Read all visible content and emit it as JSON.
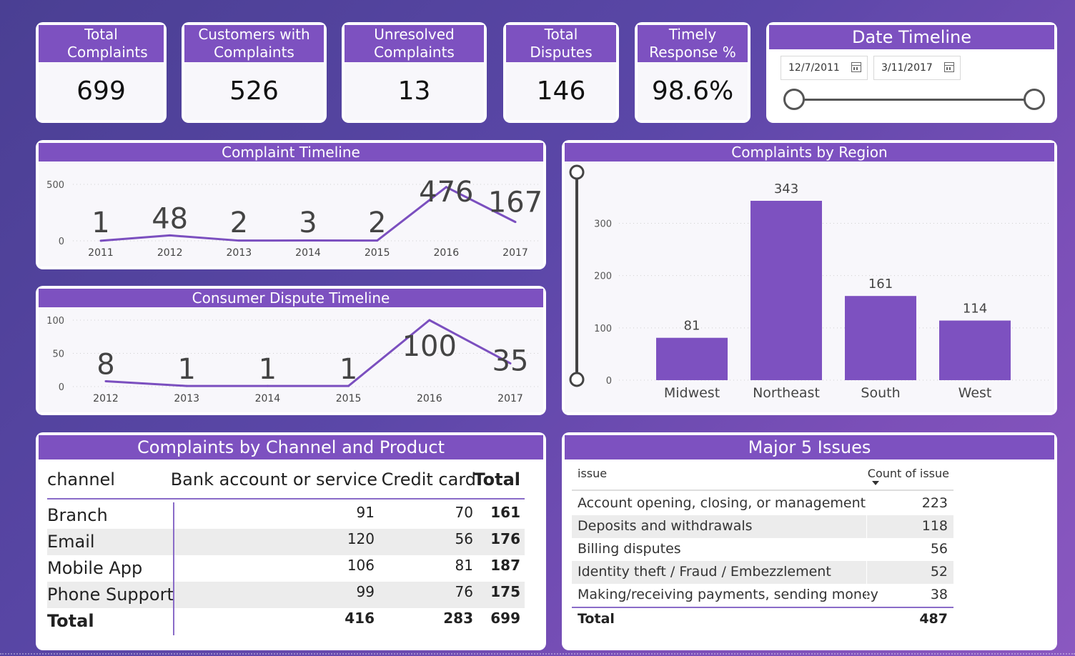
{
  "kpis": {
    "total_complaints": {
      "label": "Total Complaints",
      "value": "699"
    },
    "customers_with_complaints": {
      "label": "Customers with Complaints",
      "value": "526"
    },
    "unresolved_complaints": {
      "label": "Unresolved Complaints",
      "value": "13"
    },
    "total_disputes": {
      "label": "Total Disputes",
      "value": "146"
    },
    "timely_response": {
      "label": "Timely Response %",
      "value": "98.6%"
    }
  },
  "date_timeline": {
    "title": "Date Timeline",
    "start": "12/7/2011",
    "end": "3/11/2017",
    "icon": "calendar-icon"
  },
  "colors": {
    "accent": "#7d51c0",
    "line": "#7b4fbf",
    "bar": "#7d51c0",
    "grid": "#d0d0d0"
  },
  "chart_data": [
    {
      "id": "complaint_timeline",
      "type": "line",
      "title": "Complaint Timeline",
      "x": [
        "2011",
        "2012",
        "2013",
        "2014",
        "2015",
        "2016",
        "2017"
      ],
      "values": [
        1,
        48,
        2,
        3,
        2,
        476,
        167
      ],
      "yticks": [
        0,
        500
      ],
      "ylim": [
        0,
        500
      ],
      "grid": true,
      "data_labels": true
    },
    {
      "id": "dispute_timeline",
      "type": "line",
      "title": "Consumer Dispute Timeline",
      "x": [
        "2012",
        "2013",
        "2014",
        "2015",
        "2016",
        "2017"
      ],
      "values": [
        8,
        1,
        1,
        1,
        100,
        35
      ],
      "yticks": [
        0,
        50,
        100
      ],
      "ylim": [
        0,
        100
      ],
      "grid": true,
      "data_labels": true
    },
    {
      "id": "region",
      "type": "bar",
      "title": "Complaints by Region",
      "categories": [
        "Midwest",
        "Northeast",
        "South",
        "West"
      ],
      "values": [
        81,
        343,
        161,
        114
      ],
      "yticks": [
        0,
        100,
        200,
        300
      ],
      "ylim": [
        0,
        343
      ],
      "grid": true,
      "data_labels": true
    },
    {
      "id": "channel_product",
      "type": "table",
      "title": "Complaints by Channel and Product",
      "columns": [
        "channel",
        "Bank account or service",
        "Credit card",
        "Total"
      ],
      "rows": [
        [
          "Branch",
          "91",
          "70",
          "161"
        ],
        [
          "Email",
          "120",
          "56",
          "176"
        ],
        [
          "Mobile App",
          "106",
          "81",
          "187"
        ],
        [
          "Phone Support",
          "99",
          "76",
          "175"
        ]
      ],
      "total": [
        "Total",
        "416",
        "283",
        "699"
      ]
    },
    {
      "id": "major_issues",
      "type": "table",
      "title": "Major 5 Issues",
      "columns": [
        "issue",
        "Count of issue"
      ],
      "rows": [
        [
          "Account opening, closing, or management",
          "223"
        ],
        [
          "Deposits and withdrawals",
          "118"
        ],
        [
          "Billing disputes",
          "56"
        ],
        [
          "Identity theft / Fraud / Embezzlement",
          "52"
        ],
        [
          "Making/receiving payments, sending money",
          "38"
        ]
      ],
      "total": [
        "Total",
        "487"
      ]
    }
  ]
}
